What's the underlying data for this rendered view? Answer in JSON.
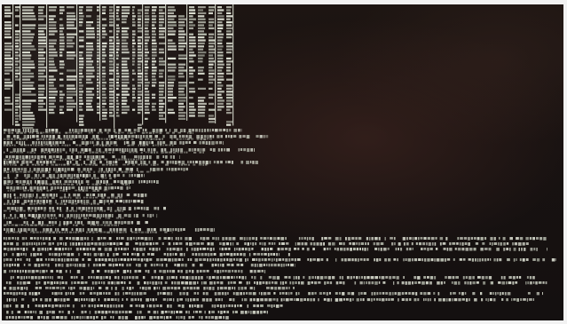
{
  "photo": {
    "subject": "",
    "screen_background": "#181211",
    "console_text_color": "#e8ecde",
    "console_text_dim_color": "#c9cfc0"
  }
}
